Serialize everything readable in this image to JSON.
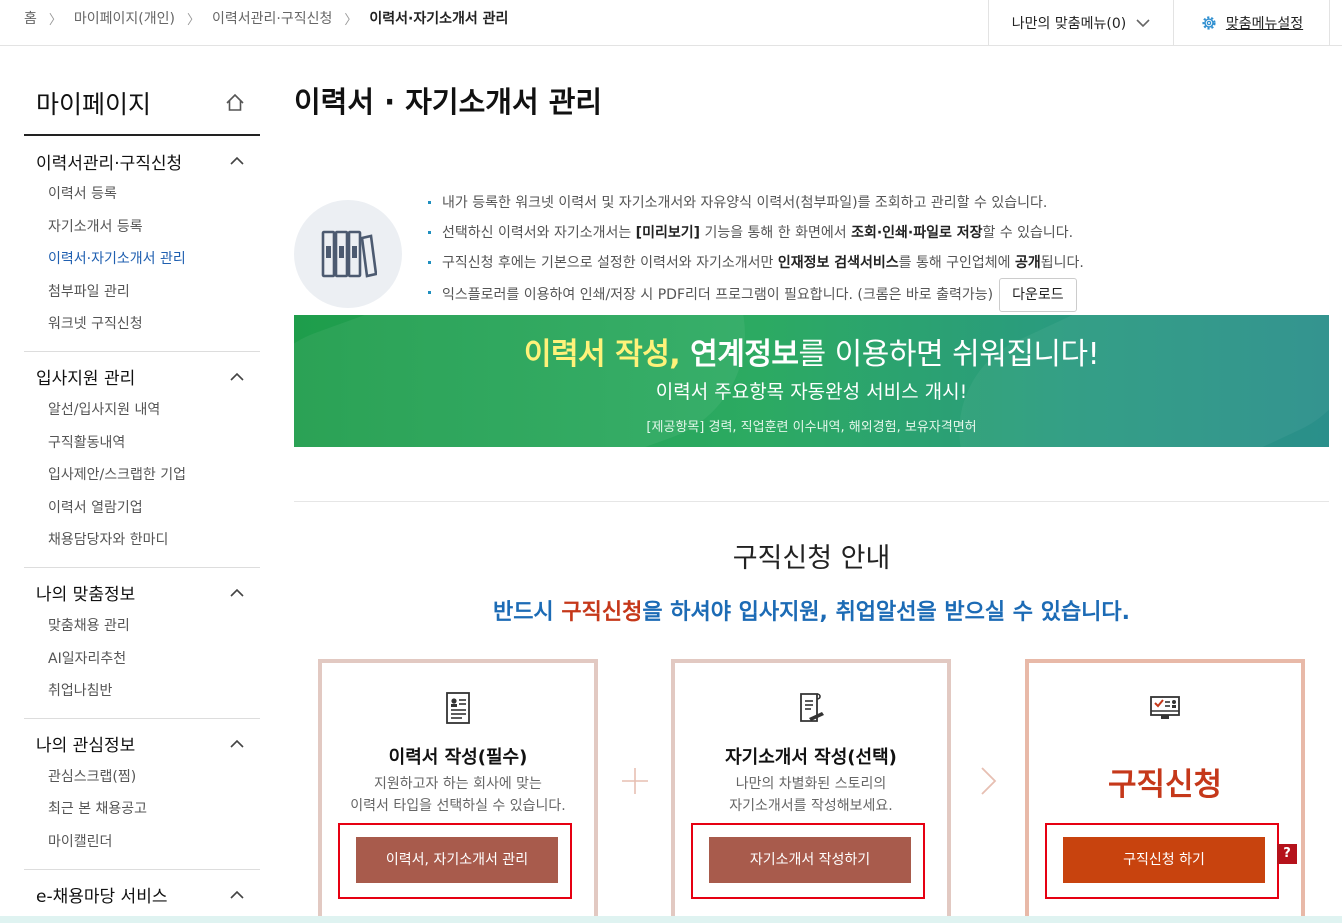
{
  "breadcrumb": {
    "items": [
      "홈",
      "마이페이지(개인)",
      "이력서관리·구직신청"
    ],
    "current": "이력서·자기소개서 관리"
  },
  "topmenu": {
    "my_menu_label": "나만의 맞춤메뉴(0)",
    "my_setting_label": "맞춤메뉴설정"
  },
  "sidebar": {
    "title": "마이페이지",
    "groups": [
      {
        "title": "이력서관리·구직신청",
        "items": [
          "이력서 등록",
          "자기소개서 등록",
          "이력서·자기소개서 관리",
          "첨부파일 관리",
          "워크넷 구직신청"
        ],
        "active_index": 2
      },
      {
        "title": "입사지원 관리",
        "items": [
          "알선/입사지원 내역",
          "구직활동내역",
          "입사제안/스크랩한 기업",
          "이력서 열람기업",
          "채용담당자와 한마디"
        ]
      },
      {
        "title": "나의 맞춤정보",
        "items": [
          "맞춤채용 관리",
          "AI일자리추천",
          "취업나침반"
        ]
      },
      {
        "title": "나의 관심정보",
        "items": [
          "관심스크랩(찜)",
          "최근 본 채용공고",
          "마이캘린더"
        ]
      },
      {
        "title": "e-채용마당 서비스",
        "items": []
      }
    ]
  },
  "main": {
    "title": "이력서 · 자기소개서 관리",
    "intro": {
      "line1": "내가 등록한 워크넷 이력서 및 자기소개서와 자유양식 이력서(첨부파일)를 조회하고 관리할 수 있습니다.",
      "line2_a": "선택하신 이력서와 자기소개서는 ",
      "line2_b": "[미리보기]",
      "line2_c": " 기능을 통해 한 화면에서 ",
      "line2_d": "조회·인쇄·파일로 저장",
      "line2_e": "할 수 있습니다.",
      "line3_a": "구직신청 후에는 기본으로 설정한 이력서와 자기소개서만 ",
      "line3_b": "인재정보 검색서비스",
      "line3_c": "를 통해 구인업체에 ",
      "line3_d": "공개",
      "line3_e": "됩니다.",
      "line4": "익스플로러를 이용하여 인쇄/저장 시 PDF리더 프로그램이 필요합니다. (크롬은 바로 출력가능)",
      "download_label": "다운로드"
    },
    "banner": {
      "line1_yellow": "이력서 작성,",
      "line1_bold": " 연계정보",
      "line1_normal": "를 이용하면 쉬워집니다!",
      "line2": "이력서 주요항목 자동완성 서비스 개시!",
      "line3": "[제공항목] 경력, 직업훈련 이수내역, 해외경험, 보유자격면허"
    },
    "guide": {
      "title": "구직신청 안내",
      "sub_a": "반드시 ",
      "sub_hl": "구직신청",
      "sub_b": "을 하셔야 입사지원, 취업알선을 받으실 수 있습니다."
    },
    "cards": [
      {
        "title": "이력서 작성(필수)",
        "desc1": "지원하고자 하는 회사에 맞는",
        "desc2": "이력서 타입을 선택하실 수 있습니다.",
        "button": "이력서, 자기소개서 관리",
        "icon": "resume-icon"
      },
      {
        "title": "자기소개서 작성(선택)",
        "desc1": "나만의 차별화된 스토리의",
        "desc2": "자기소개서를 작성해보세요.",
        "button": "자기소개서 작성하기",
        "icon": "document-pen-icon"
      },
      {
        "title": "구직신청",
        "button": "구직신청 하기",
        "icon": "monitor-check-icon"
      }
    ],
    "help_label": "?"
  },
  "colors": {
    "accent_blue": "#1c6bb5",
    "accent_red": "#c5381a",
    "button_brown": "#a85b4c",
    "button_orange": "#c8430e",
    "highlight_box": "#e60012",
    "banner_green": "#1e9d4b"
  }
}
